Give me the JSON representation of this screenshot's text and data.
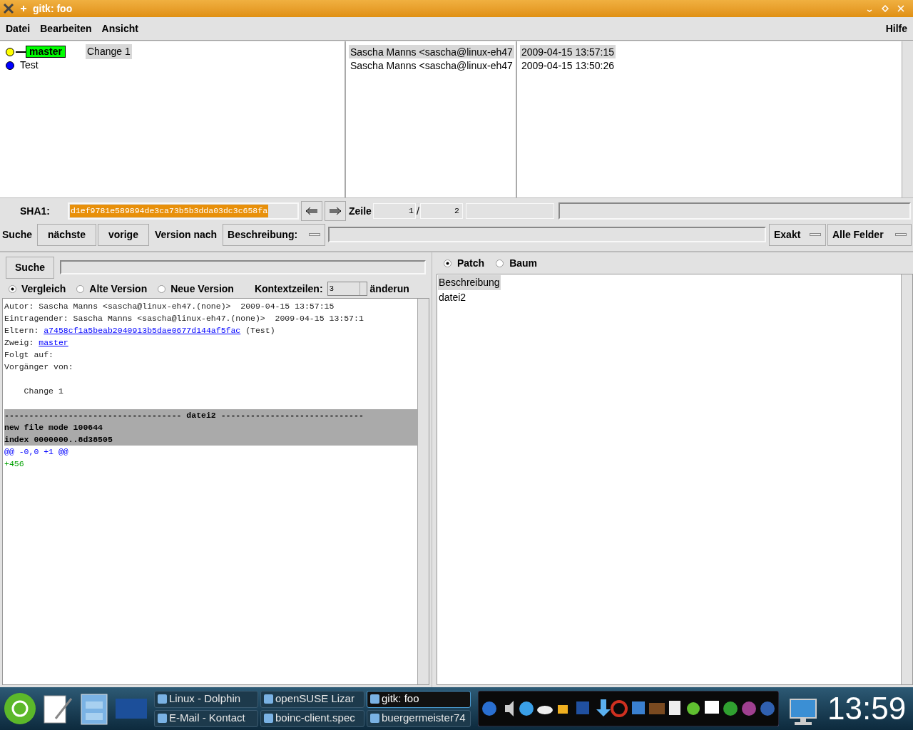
{
  "window": {
    "title": "gitk: foo"
  },
  "menu": [
    {
      "label": "Datei"
    },
    {
      "label": "Bearbeiten"
    },
    {
      "label": "Ansicht"
    }
  ],
  "help_menu": {
    "label": "Hilfe"
  },
  "commits": [
    {
      "color": "#ffff00",
      "refs": [
        {
          "label": "master",
          "kind": "head"
        }
      ],
      "headline": "Change 1",
      "author": "Sascha Manns <sascha@linux-eh47",
      "date": "2009-04-15 13:57:15",
      "selected": true
    },
    {
      "color": "#0000ff",
      "headline": "Test",
      "author": "Sascha Manns <sascha@linux-eh47",
      "date": "2009-04-15 13:50:26",
      "selected": false
    }
  ],
  "sha_row": {
    "label": "SHA1:",
    "value": "d1ef9781e589894de3ca73b5b3dda03dc3c658fa",
    "line_label": "Zeile",
    "line": "1",
    "separator": "/",
    "total": "2"
  },
  "find_row": {
    "label": "Suche",
    "buttons": [
      "nächste",
      "vorige"
    ],
    "version_label": "Version nach",
    "type_menu": "Beschreibung:",
    "mode_menu": "Exakt",
    "fields_menu": "Alle Felder"
  },
  "diff_search": {
    "button": "Suche",
    "modes": [
      {
        "label": "Vergleich",
        "selected": true
      },
      {
        "label": "Alte Version",
        "selected": false
      },
      {
        "label": "Neue Version",
        "selected": false
      }
    ],
    "context_label": "Kontextzeilen:",
    "context_value": "3",
    "cut_label": "änderun"
  },
  "details": [
    {
      "kind": "plain",
      "text": "Autor: Sascha Manns <sascha@linux-eh47.(none)>  2009-04-15 13:57:15"
    },
    {
      "kind": "plain",
      "text": "Eintragender: Sascha Manns <sascha@linux-eh47.(none)>  2009-04-15 13:57:1"
    },
    {
      "kind": "link",
      "prefix": "Eltern: ",
      "link": "a7458cf1a5beab2040913b5dae0677d144af5fac",
      "suffix": " (Test)"
    },
    {
      "kind": "link",
      "prefix": "Zweig: ",
      "link": "master"
    },
    {
      "kind": "plain",
      "text": "Folgt auf:"
    },
    {
      "kind": "plain",
      "text": "Vorgänger von:"
    },
    {
      "kind": "blank"
    },
    {
      "kind": "plain",
      "text": "    Change 1"
    },
    {
      "kind": "blank"
    },
    {
      "kind": "file_header",
      "text": "------------------------------------ datei2 -----------------------------"
    },
    {
      "kind": "header",
      "text": "new file mode 100644"
    },
    {
      "kind": "header",
      "text": "index 0000000..8d38505"
    },
    {
      "kind": "hunk",
      "text": "@@ -0,0 +1 @@"
    },
    {
      "kind": "added",
      "text": "+456"
    }
  ],
  "view_modes": [
    {
      "label": "Patch",
      "selected": true
    },
    {
      "label": "Baum",
      "selected": false
    }
  ],
  "files": [
    {
      "label": "Beschreibung",
      "selected": true
    },
    {
      "label": "datei2",
      "selected": false
    }
  ],
  "taskbar": {
    "tasks": [
      {
        "label": "Linux - Dolphin",
        "active": false
      },
      {
        "label": "openSUSE Lizar",
        "active": false
      },
      {
        "label": "gitk: foo",
        "active": true
      },
      {
        "label": "E-Mail - Kontact",
        "active": false
      },
      {
        "label": "boinc-client.spec",
        "active": false
      },
      {
        "label": "buergermeister74",
        "active": false
      }
    ],
    "clock": "13:59"
  }
}
